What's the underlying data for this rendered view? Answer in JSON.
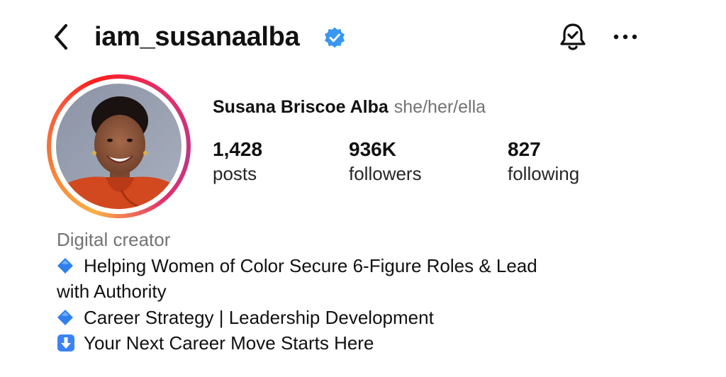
{
  "header": {
    "username": "iam_susanaalba",
    "back_icon": "chevron-left-icon",
    "verified_icon": "verified-badge-icon",
    "bell_icon": "notification-bell-check-icon",
    "more_icon": "more-horizontal-icon"
  },
  "profile": {
    "display_name": "Susana Briscoe Alba",
    "pronouns": "she/her/ella",
    "stats": [
      {
        "count": "1,428",
        "label": "posts"
      },
      {
        "count": "936K",
        "label": "followers"
      },
      {
        "count": "827",
        "label": "following"
      }
    ]
  },
  "bio": {
    "category": "Digital creator",
    "line1": "Helping Women of Color Secure 6-Figure Roles & Lead",
    "line1_cont": "with Authority",
    "line2": "Career Strategy | Leadership Development",
    "line3": "Your Next Career Move Starts Here"
  },
  "colors": {
    "verified_blue": "#3897f0",
    "secondary_text": "#737373",
    "diamond_blue": "#2f80ed",
    "arrow_box_blue": "#3b82f6"
  }
}
